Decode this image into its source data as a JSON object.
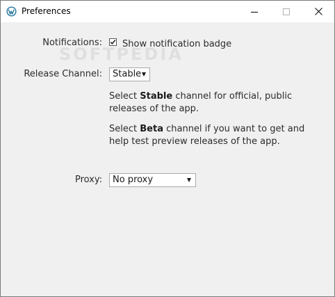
{
  "window": {
    "title": "Preferences",
    "app_icon": "wordpress-icon",
    "controls": [
      "minimize-icon",
      "maximize-icon",
      "close-icon"
    ]
  },
  "notifications": {
    "label": "Notifications:",
    "checkbox_label": "Show notification badge",
    "checked": true
  },
  "release_channel": {
    "label": "Release Channel:",
    "selected": "Stable",
    "stable_text": {
      "pre": "Select ",
      "bold": "Stable",
      "post": " channel for official, public releases of the app."
    },
    "beta_text": {
      "pre": "Select ",
      "bold": "Beta",
      "post": " channel if you want to get and help test preview releases of the app."
    }
  },
  "proxy": {
    "label": "Proxy:",
    "selected": "No proxy"
  },
  "watermark": "SOFTPEDIA",
  "colors": {
    "background": "#f0f0f0",
    "titlebar": "#ffffff",
    "wordpress_blue": "#21759b"
  }
}
